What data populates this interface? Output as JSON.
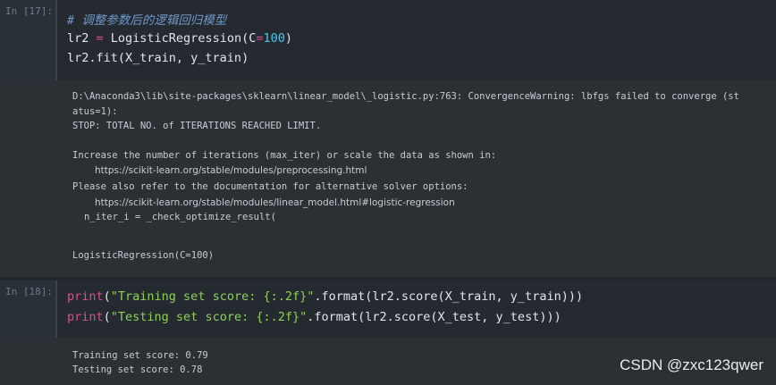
{
  "cells": [
    {
      "prompt": "In [17]:",
      "code": {
        "comment": "# 调整参数后的逻辑回归模型",
        "line1": {
          "var": "lr2",
          "op": " = ",
          "call": "LogisticRegression(",
          "param": "C",
          "eq": "=",
          "num": "100",
          "close": ")"
        },
        "line2": "lr2.fit(X_train, y_train)"
      },
      "output": {
        "warn1": "D:\\Anaconda3\\lib\\site-packages\\sklearn\\linear_model\\_logistic.py:763: ConvergenceWarning: lbfgs failed to converge (st",
        "warn2": "atus=1):",
        "warn3": "STOP: TOTAL NO. of ITERATIONS REACHED LIMIT.",
        "warn4": "Increase the number of iterations (max_iter) or scale the data as shown in:",
        "link1": "https://scikit-learn.org/stable/modules/preprocessing.html",
        "warn5": "Please also refer to the documentation for alternative solver options:",
        "link2": "https://scikit-learn.org/stable/modules/linear_model.html#logistic-regression",
        "warn6": "n_iter_i = _check_optimize_result(",
        "result": "LogisticRegression(C=100)"
      }
    },
    {
      "prompt": "In [18]:",
      "code": {
        "line1": {
          "fn": "print",
          "open": "(",
          "str": "\"Training set score: {:.2f}\"",
          "rest": ".format(lr2.score(X_train, y_train)))"
        },
        "line2": {
          "fn": "print",
          "open": "(",
          "str": "\"Testing set score: {:.2f}\"",
          "rest": ".format(lr2.score(X_test, y_test)))"
        }
      },
      "output": {
        "line1": "Training set score: 0.79",
        "line2": "Testing set score: 0.78"
      }
    }
  ],
  "watermark": "CSDN @zxc123qwer"
}
